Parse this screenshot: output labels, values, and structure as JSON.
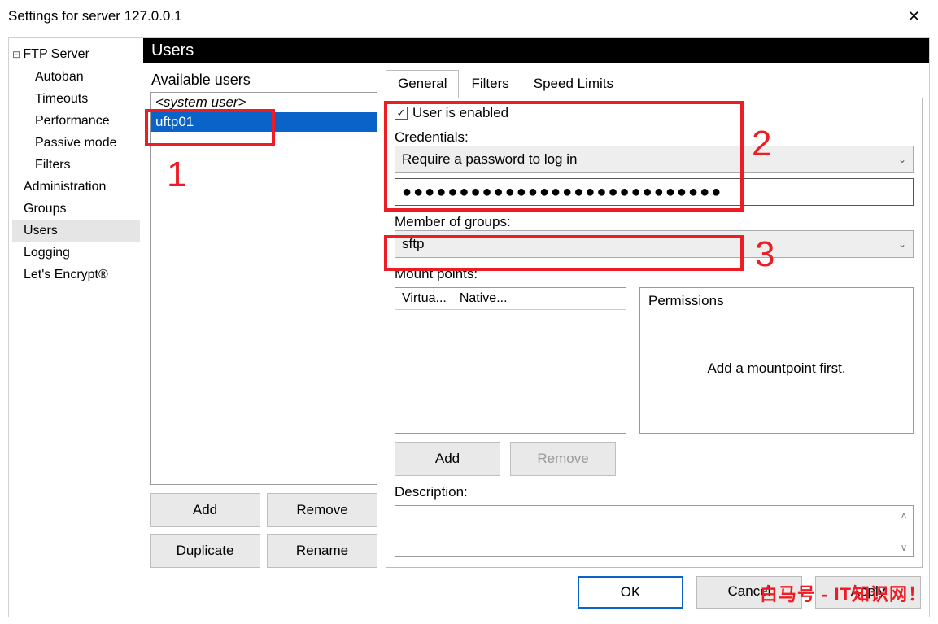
{
  "window": {
    "title": "Settings for server 127.0.0.1"
  },
  "tree": {
    "root": "FTP Server",
    "children": [
      "Autoban",
      "Timeouts",
      "Performance",
      "Passive mode",
      "Filters"
    ],
    "top": [
      "Administration",
      "Groups",
      "Users",
      "Logging",
      "Let's Encrypt®"
    ],
    "selected": "Users"
  },
  "section": {
    "title": "Users"
  },
  "users": {
    "label": "Available users",
    "items": [
      "<system user>",
      "uftp01"
    ],
    "selected": "uftp01",
    "buttons": {
      "add": "Add",
      "remove": "Remove",
      "duplicate": "Duplicate",
      "rename": "Rename"
    }
  },
  "tabs": {
    "items": [
      "General",
      "Filters",
      "Speed Limits"
    ],
    "active": "General"
  },
  "general": {
    "enabled_label": "User is enabled",
    "enabled": true,
    "credentials_label": "Credentials:",
    "credentials_mode": "Require a password to log in",
    "password_mask": "●●●●●●●●●●●●●●●●●●●●●●●●●●●●",
    "groups_label": "Member of groups:",
    "group_value": "sftp",
    "mount_label": "Mount points:",
    "mount_cols": [
      "Virtua...",
      "Native..."
    ],
    "permissions_label": "Permissions",
    "permissions_empty": "Add a mountpoint first.",
    "mount_buttons": {
      "add": "Add",
      "remove": "Remove"
    },
    "description_label": "Description:"
  },
  "footer": {
    "ok": "OK",
    "cancel": "Cancel",
    "apply": "Apply"
  },
  "annotations": {
    "n1": "1",
    "n2": "2",
    "n3": "3"
  },
  "watermark": "白马号 - IT知识网！"
}
